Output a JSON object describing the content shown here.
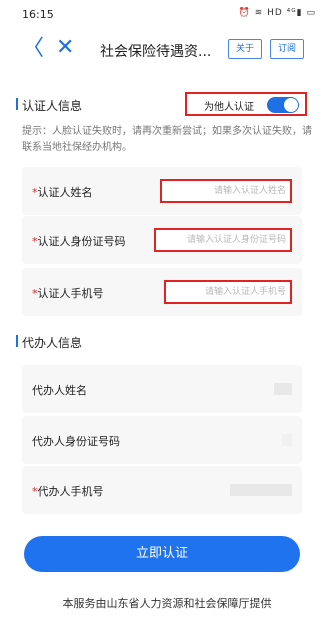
{
  "status_bar": {
    "time": "16:15",
    "icons": "⏰ ≋ HD ⁴ᴳ▮ ▭"
  },
  "nav": {
    "back": "〈",
    "close": "✕",
    "title": "社会保险待遇资...",
    "about_label": "关于",
    "subscribe_label": "订阅"
  },
  "certifier_section": {
    "title": "认证人信息",
    "toggle_label": "为他人认证",
    "toggle_on": true,
    "hint": "提示：人脸认证失败时，请再次重新尝试；如果多次认证失败，请联系当地社保经办机构。",
    "fields": [
      {
        "required": "*",
        "label": "认证人姓名",
        "placeholder": "请输入认证人姓名"
      },
      {
        "required": "*",
        "label": "认证人身份证号码",
        "placeholder": "请输入认证人身份证号码"
      },
      {
        "required": "*",
        "label": "认证人手机号",
        "placeholder": "请输入认证人手机号"
      }
    ]
  },
  "agent_section": {
    "title": "代办人信息",
    "fields": [
      {
        "required": "",
        "label": "代办人姓名"
      },
      {
        "required": "",
        "label": "代办人身份证号码"
      },
      {
        "required": "*",
        "label": "代办人手机号"
      }
    ]
  },
  "submit_label": "立即认证",
  "footer": "本服务由山东省人力资源和社会保障厅提供",
  "colors": {
    "accent": "#1f73ef",
    "highlight": "#e02424",
    "required": "#e02424"
  }
}
